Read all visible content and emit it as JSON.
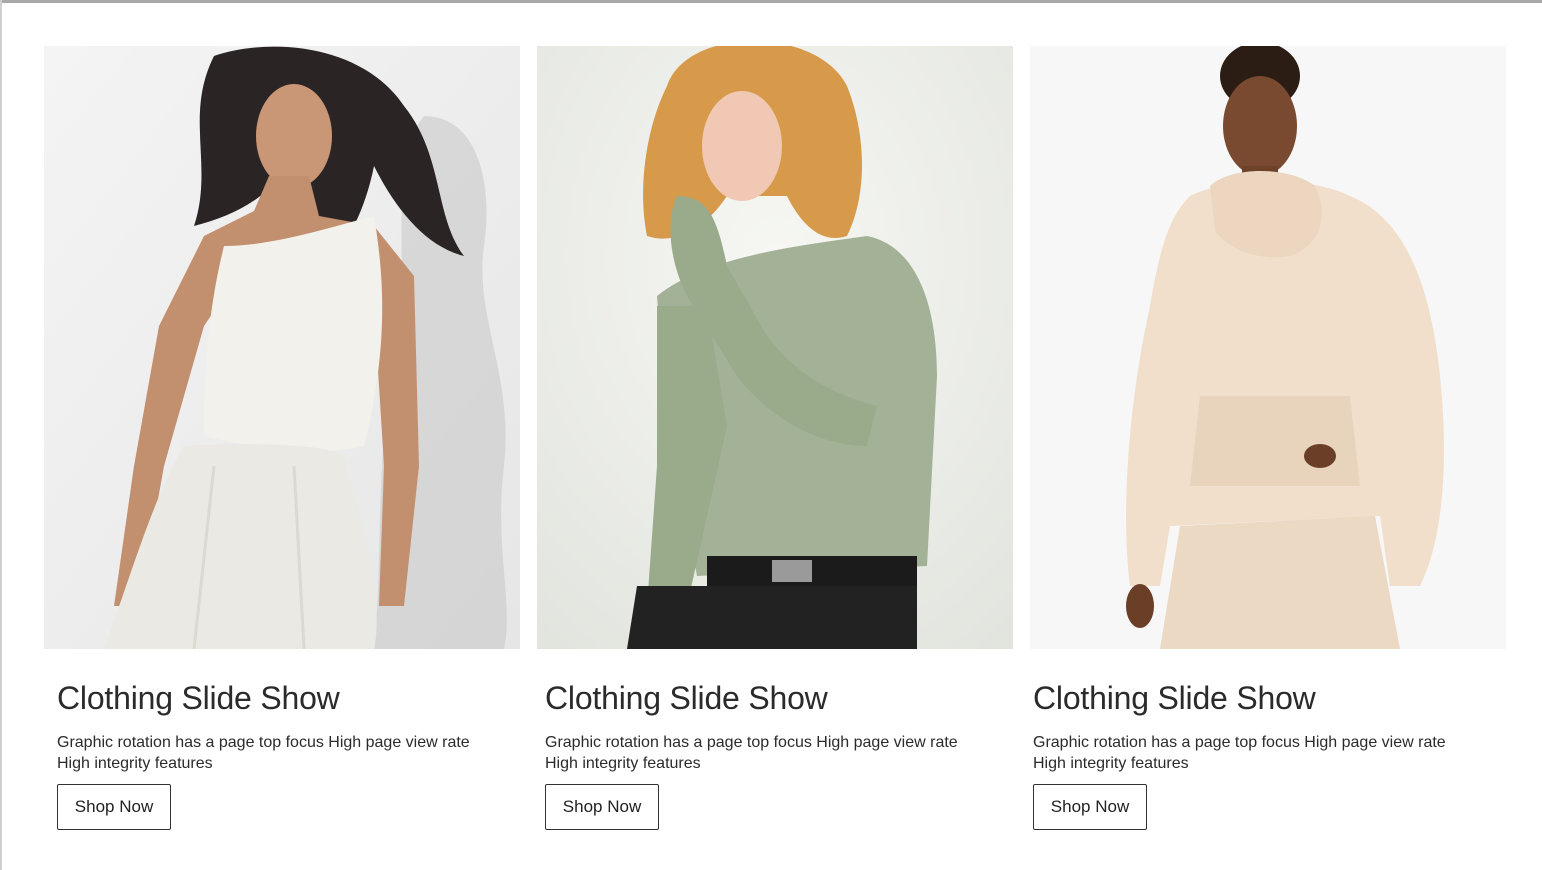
{
  "slides": [
    {
      "title": "Clothing Slide Show",
      "description": "Graphic rotation has a page top focus High page view rate High integrity features",
      "button_label": "Shop Now",
      "image": "woman-white-top-photo",
      "garment_color": "#f2f1ec"
    },
    {
      "title": "Clothing Slide Show",
      "description": "Graphic rotation has a page top focus High page view rate High integrity features",
      "button_label": "Shop Now",
      "image": "woman-green-top-photo",
      "garment_color": "#a3b296"
    },
    {
      "title": "Clothing Slide Show",
      "description": "Graphic rotation has a page top focus High page view rate High integrity features",
      "button_label": "Shop Now",
      "image": "woman-beige-hoodie-photo",
      "garment_color": "#f1dfcb"
    }
  ]
}
